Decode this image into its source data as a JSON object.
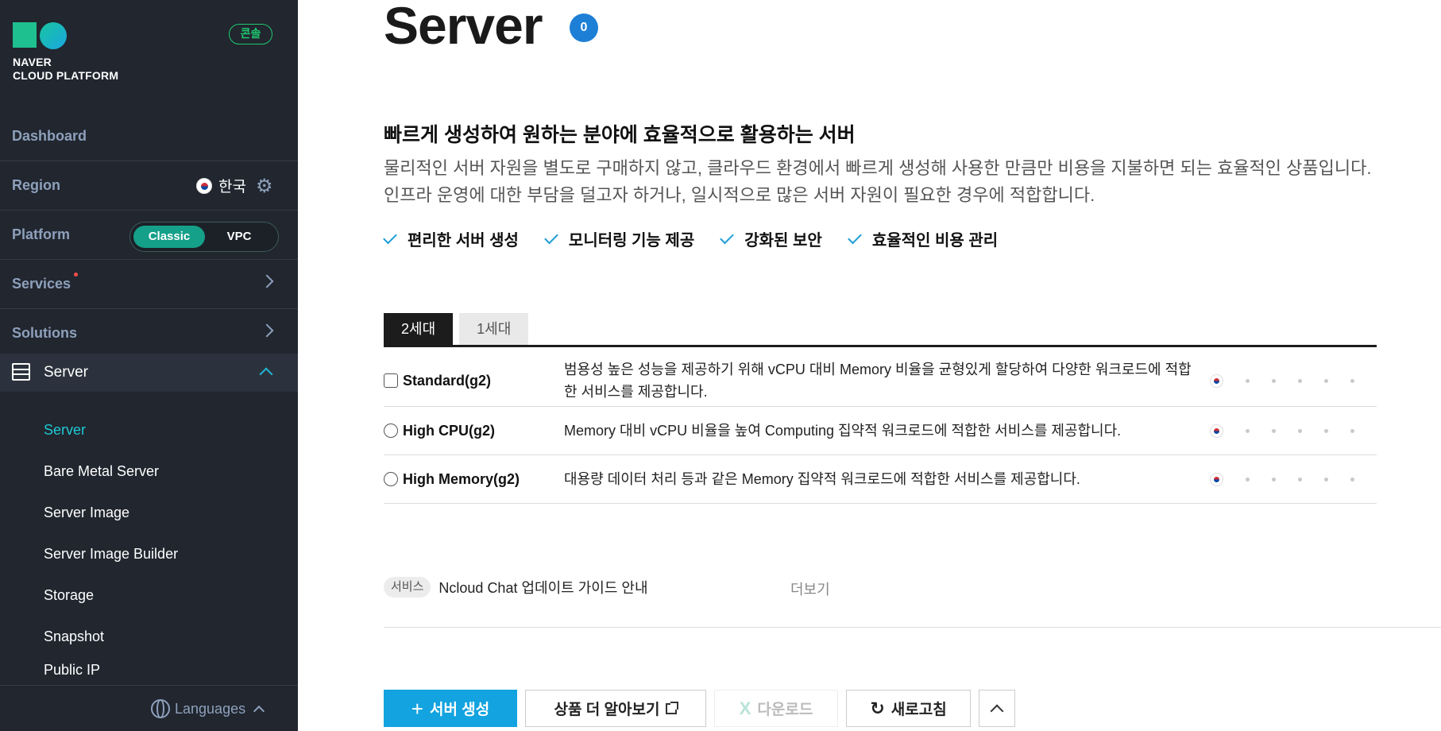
{
  "brand": {
    "line1": "NAVER",
    "line2": "CLOUD PLATFORM",
    "console_badge": "콘솔"
  },
  "sidebar": {
    "dashboard": "Dashboard",
    "region_label": "Region",
    "region_value": "한국",
    "platform_label": "Platform",
    "platform_options": [
      "Classic",
      "VPC"
    ],
    "platform_selected": "Classic",
    "services": "Services",
    "solutions": "Solutions",
    "server_section": "Server",
    "sub_items": [
      "Server",
      "Bare Metal Server",
      "Server Image",
      "Server Image Builder",
      "Storage",
      "Snapshot",
      "Public IP"
    ],
    "active_sub": "Server",
    "languages": "Languages"
  },
  "main": {
    "title": "Server",
    "count": "0",
    "headline": "빠르게 생성하여 원하는 분야에 효율적으로 활용하는 서버",
    "desc_line1": "물리적인 서버 자원을 별도로 구매하지 않고, 클라우드 환경에서 빠르게 생성해 사용한 만큼만 비용을 지불하면 되는 효율적인 상품입니다.",
    "desc_line2": "인프라 운영에 대한 부담을 덜고자 하거나, 일시적으로 많은 서버 자원이 필요한 경우에 적합합니다.",
    "features": [
      "편리한 서버 생성",
      "모니터링 기능 제공",
      "강화된 보안",
      "효율적인 비용 관리"
    ],
    "tabs": [
      "2세대",
      "1세대"
    ],
    "active_tab": "2세대",
    "products": [
      {
        "name": "Standard(g2)",
        "desc": "범용성 높은 성능을 제공하기 위해 vCPU 대비 Memory 비율을 균형있게 할당하여 다양한 워크로드에 적합한 서비스를 제공합니다."
      },
      {
        "name": "High CPU(g2)",
        "desc": "Memory 대비 vCPU 비율을 높여 Computing 집약적 워크로드에 적합한 서비스를 제공합니다."
      },
      {
        "name": "High Memory(g2)",
        "desc": "대용량 데이터 처리 등과 같은 Memory 집약적 워크로드에 적합한 서비스를 제공합니다."
      }
    ],
    "notice": {
      "tag": "서비스",
      "text": "Ncloud Chat 업데이트 가이드 안내",
      "more": "더보기"
    },
    "buttons": {
      "create": "서버 생성",
      "learn_more": "상품 더 알아보기",
      "download": "다운로드",
      "refresh": "새로고침"
    }
  },
  "colors": {
    "sidebar_bg": "#21262f",
    "accent_teal": "#15a08a",
    "primary_blue": "#13a3e0",
    "active_link": "#1fc9d4"
  }
}
